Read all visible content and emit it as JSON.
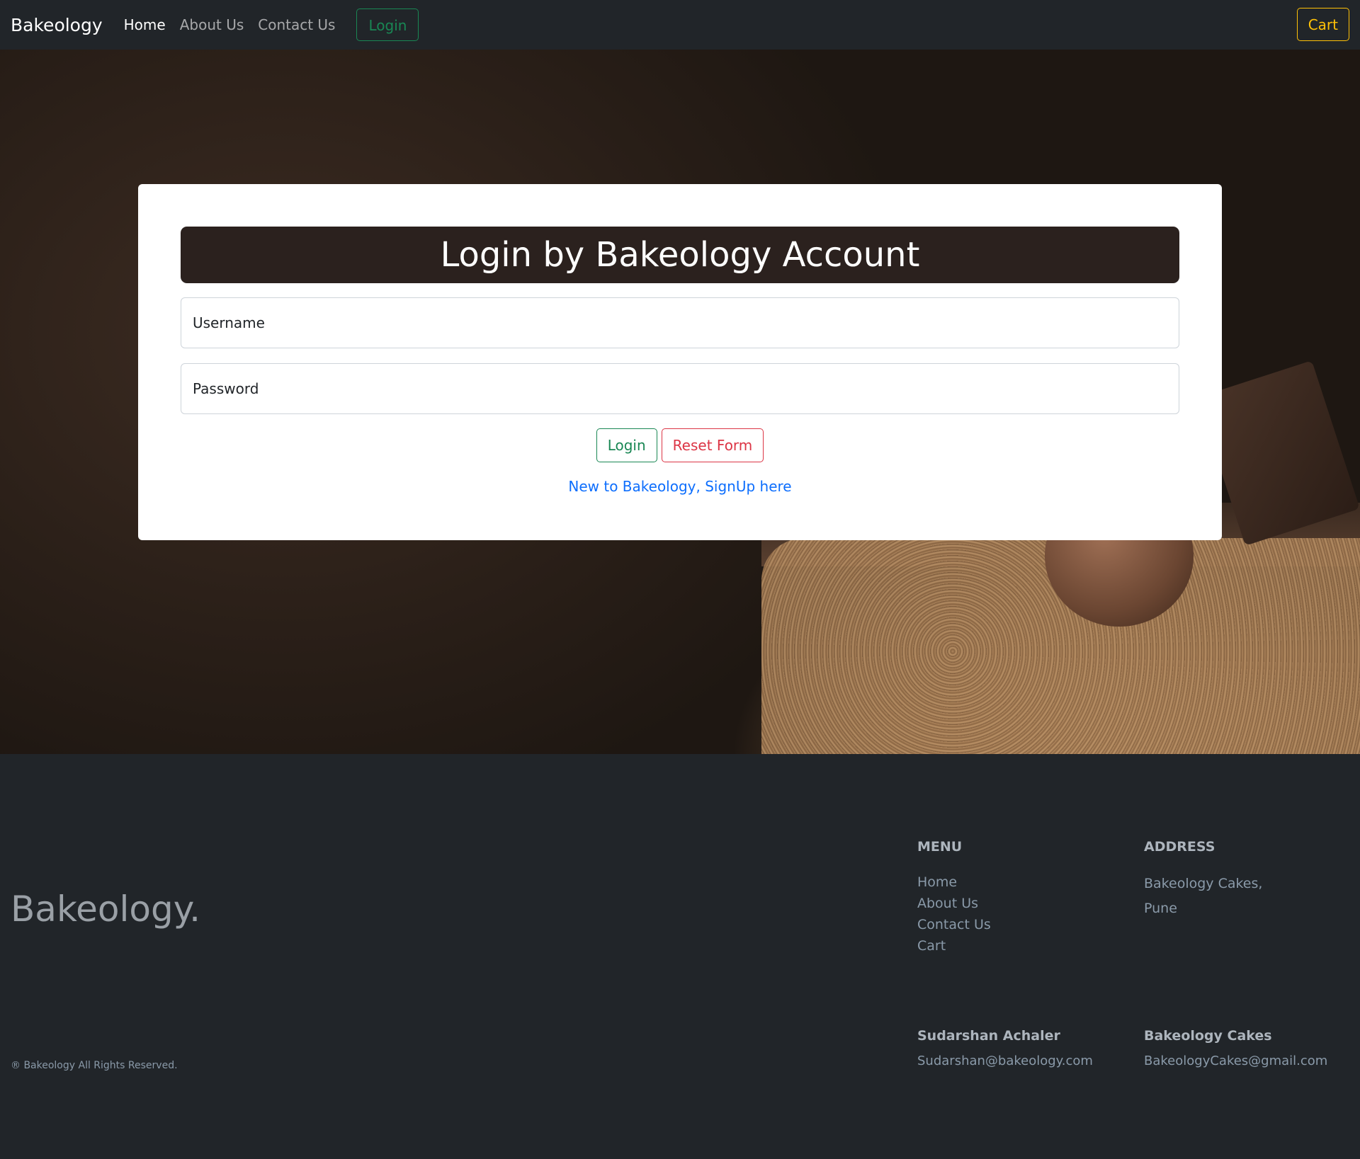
{
  "navbar": {
    "brand": "Bakeology",
    "links": [
      "Home",
      "About Us",
      "Contact Us"
    ],
    "login_label": "Login",
    "cart_label": "Cart"
  },
  "login_card": {
    "title": "Login by Bakeology Account",
    "username_placeholder": "Username",
    "password_placeholder": "Password",
    "login_button": "Login",
    "reset_button": "Reset Form",
    "signup_link": "New to Bakeology, SignUp here"
  },
  "footer": {
    "brand": "Bakeology.",
    "copyright": "® Bakeology All Rights Reserved.",
    "menu": {
      "heading": "MENU",
      "items": [
        "Home",
        "About Us",
        "Contact Us",
        "Cart"
      ]
    },
    "address": {
      "heading": "ADDRESS",
      "lines": [
        "Bakeology Cakes,",
        "Pune"
      ]
    },
    "contacts": [
      {
        "name": "Sudarshan Achaler",
        "email": "Sudarshan@bakeology.com"
      },
      {
        "name": "Bakeology Cakes",
        "email": "BakeologyCakes@gmail.com"
      }
    ]
  },
  "colors": {
    "navbar_bg": "#212529",
    "success": "#198754",
    "danger": "#dc3545",
    "warning": "#ffc107",
    "link": "#0d6efd",
    "title_bg": "#2b211e"
  }
}
